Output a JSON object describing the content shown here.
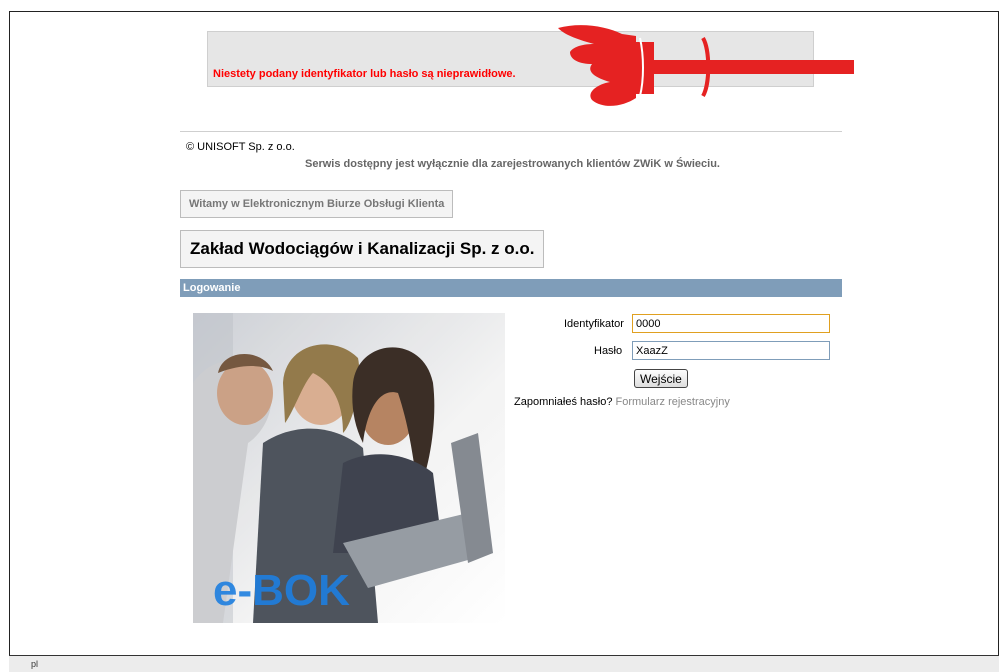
{
  "error": {
    "message": "Niestety podany identyfikator lub hasło są nieprawidłowe."
  },
  "footer_info": {
    "copyright": "© UNISOFT Sp. z o.o.",
    "notice": "Serwis dostępny jest wyłącznie dla zarejestrowanych klientów ZWiK w Świeciu."
  },
  "welcome_button": "Witamy w Elektronicznym Biurze Obsługi Klienta",
  "company_name": "Zakład Wodociągów i Kanalizacji Sp. z o.o.",
  "login": {
    "header": "Logowanie",
    "id_label": "Identyfikator",
    "id_value": "0000",
    "password_label": "Hasło",
    "password_value": "XaazZ",
    "submit": "Wejście",
    "forgot_prefix": "Zapomniałeś hasło?",
    "register_link": "Formularz rejestracyjny"
  },
  "logo_text": "e-BOK",
  "status_bar": {
    "language": "pl"
  },
  "colors": {
    "error": "#ff0000",
    "hand": "#e52222",
    "login_bar": "#7f9db9",
    "logo": "#1e7fe0"
  }
}
